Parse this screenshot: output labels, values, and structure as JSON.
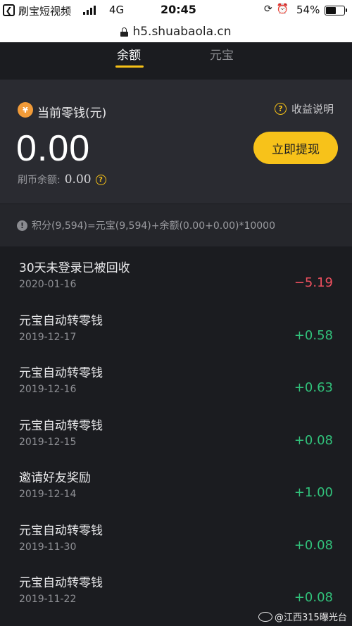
{
  "status_bar": {
    "app_name": "刷宝短视频",
    "network": "4G",
    "time": "20:45",
    "battery": "54%",
    "battery_level": 0.54
  },
  "url_bar": {
    "url": "h5.shuabaola.cn"
  },
  "tabs": [
    {
      "label": "余额",
      "active": true
    },
    {
      "label": "元宝",
      "active": false
    }
  ],
  "balance_card": {
    "title": "当前零钱(元)",
    "help_label": "收益说明",
    "amount": "0.00",
    "withdraw_label": "立即提现",
    "coin_balance_label": "刷币余额:",
    "coin_balance_value": "0.00"
  },
  "note": "积分(9,594)=元宝(9,594)+余额(0.00+0.00)*10000",
  "transactions": [
    {
      "title": "30天未登录已被回收",
      "date": "2020-01-16",
      "amount": "−5.19",
      "type": "neg"
    },
    {
      "title": "元宝自动转零钱",
      "date": "2019-12-17",
      "amount": "+0.58",
      "type": "pos"
    },
    {
      "title": "元宝自动转零钱",
      "date": "2019-12-16",
      "amount": "+0.63",
      "type": "pos"
    },
    {
      "title": "元宝自动转零钱",
      "date": "2019-12-15",
      "amount": "+0.08",
      "type": "pos"
    },
    {
      "title": "邀请好友奖励",
      "date": "2019-12-14",
      "amount": "+1.00",
      "type": "pos"
    },
    {
      "title": "元宝自动转零钱",
      "date": "2019-11-30",
      "amount": "+0.08",
      "type": "pos"
    },
    {
      "title": "元宝自动转零钱",
      "date": "2019-11-22",
      "amount": "+0.08",
      "type": "pos"
    }
  ],
  "watermark": "@江西315曝光台",
  "colors": {
    "accent": "#f7c21a",
    "negative": "#f0505f",
    "positive": "#31c27b",
    "background": "#1b1c20"
  }
}
